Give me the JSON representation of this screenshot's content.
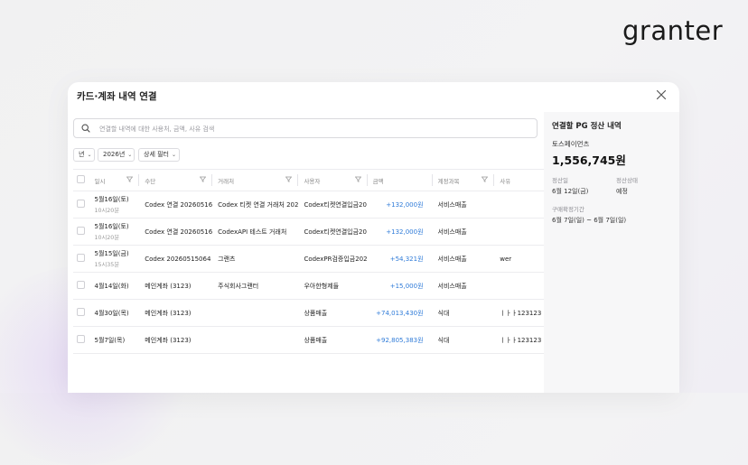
{
  "brand": {
    "logo": "granter"
  },
  "modal": {
    "title": "카드·계좌 내역 연결",
    "search": {
      "placeholder": "연결할 내역에 대한 사용처, 금액, 사유 검색",
      "value": ""
    },
    "filters": [
      {
        "label": "년"
      },
      {
        "label": "2026년"
      },
      {
        "label": "상세 필터"
      }
    ],
    "table": {
      "headers": [
        "일시",
        "수단",
        "거래처",
        "사용자",
        "금액",
        "계정과목",
        "사유"
      ],
      "rows": [
        {
          "date": "5월16일(토)",
          "time": "10시20분",
          "method": "Codex 연결 20260516",
          "vendor": "Codex 티켓 연결 거래처 202",
          "user": "Codex티켓연결입금20",
          "amount": "+132,000원",
          "account": "서비스매출",
          "reason": ""
        },
        {
          "date": "5월16일(토)",
          "time": "10시20분",
          "method": "Codex 연결 20260516",
          "vendor": "CodexAPI 테스트 거래처",
          "user": "Codex티켓연결입금20",
          "amount": "+132,000원",
          "account": "서비스매출",
          "reason": ""
        },
        {
          "date": "5월15일(금)",
          "time": "15시35분",
          "method": "Codex 20260515064",
          "vendor": "그랜츠",
          "user": "CodexPR검증입금202",
          "amount": "+54,321원",
          "account": "서비스매출",
          "reason": "wer"
        },
        {
          "date": "4월14일(화)",
          "time": "",
          "method": "메인계좌 (3123)",
          "vendor": "주식회사그랜터",
          "user": "우아한형제들",
          "amount": "+15,000원",
          "account": "서비스매출",
          "reason": ""
        },
        {
          "date": "4월30일(목)",
          "time": "",
          "method": "메인계좌 (3123)",
          "vendor": "",
          "user": "상품매출",
          "amount": "+74,013,430원",
          "account": "식대",
          "reason": "ㅣㅏㅏ123123"
        },
        {
          "date": "5월7일(목)",
          "time": "",
          "method": "메인계좌 (3123)",
          "vendor": "",
          "user": "상품매출",
          "amount": "+92,805,383원",
          "account": "식대",
          "reason": "ㅣㅏㅏ123123"
        }
      ]
    },
    "pg_panel": {
      "title": "연결할 PG 정산 내역",
      "provider": "토스페이먼츠",
      "amount": "1,556,745원",
      "settle_date_label": "정산일",
      "settle_date": "6월 12일(금)",
      "status_label": "정산상태",
      "status": "예정",
      "period_label": "구매확정기간",
      "period": "6월 7일(일) ~ 6월 7일(일)"
    }
  },
  "colors": {
    "amount": "#2f7bd8",
    "panel_bg": "#f7f7f8"
  }
}
